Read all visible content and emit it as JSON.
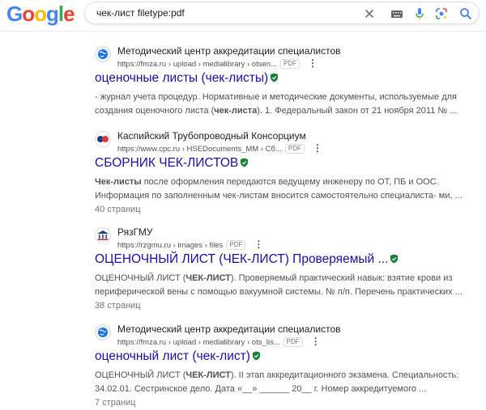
{
  "header": {
    "logo_letters": [
      {
        "ch": "G",
        "color": "#4285f4"
      },
      {
        "ch": "o",
        "color": "#ea4335"
      },
      {
        "ch": "o",
        "color": "#fbbc05"
      },
      {
        "ch": "g",
        "color": "#4285f4"
      },
      {
        "ch": "l",
        "color": "#34a853"
      },
      {
        "ch": "e",
        "color": "#ea4335"
      }
    ],
    "search_query": "чек-лист filetype:pdf",
    "icons": [
      "close-icon",
      "keyboard-icon",
      "microphone-icon",
      "lens-icon",
      "search-icon"
    ]
  },
  "results": [
    {
      "favicon": "globe-icon",
      "site_name": "Методический центр аккредитации специалистов",
      "url": "https://fmza.ru › upload › medialibrary › otsen...",
      "file_type": "PDF",
      "title": "оценочные листы (чек-листы)",
      "verified": true,
      "snippet_parts": [
        {
          "text": "- журнал учета процедур. Нормативные и методические документы, используемые для создания оценочного листа (",
          "bold": false
        },
        {
          "text": "чек-листа",
          "bold": true
        },
        {
          "text": "). 1. Федеральный закон от 21 ноября 2011 № ...",
          "bold": false
        }
      ],
      "pages": ""
    },
    {
      "favicon": "cpc-logo-icon",
      "site_name": "Каспийский Трубопроводный Консорциум",
      "url": "https://www.cpc.ru › HSEDocuments_MM › Сб...",
      "file_type": "PDF",
      "title": "СБОРНИК ЧЕК-ЛИСТОВ",
      "verified": true,
      "snippet_parts": [
        {
          "text": "Чек-листы",
          "bold": true
        },
        {
          "text": " после оформления передаются ведущему инженеру по ОТ, ПБ и ООС. Информация по заполненным чек-листам вносится самостоятельно специалиста- ми, ...",
          "bold": false
        }
      ],
      "pages": "40 страниц"
    },
    {
      "favicon": "rzgmu-emblem-icon",
      "site_name": "РязГМУ",
      "url": "https://rzgmu.ru › images › files",
      "file_type": "PDF",
      "title": "ОЦЕНОЧНЫЙ ЛИСТ (ЧЕК-ЛИСТ) Проверяемый ...",
      "verified": true,
      "snippet_parts": [
        {
          "text": "ОЦЕНОЧНЫЙ ЛИСТ (",
          "bold": false
        },
        {
          "text": "ЧЕК-ЛИСТ",
          "bold": true
        },
        {
          "text": "). Проверяемый практический навык: взятие крови из периферической вены с помощью вакуумной системы. № п/п. Перечень практических ...",
          "bold": false
        }
      ],
      "pages": "38 страниц"
    },
    {
      "favicon": "globe-icon",
      "site_name": "Методический центр аккредитации специалистов",
      "url": "https://fmza.ru › upload › medialibrary › ots_lis...",
      "file_type": "PDF",
      "title": "оценочный лист (чек-лист)",
      "verified": true,
      "snippet_parts": [
        {
          "text": "ОЦЕНОЧНЫЙ ЛИСТ (",
          "bold": false
        },
        {
          "text": "ЧЕК-ЛИСТ",
          "bold": true
        },
        {
          "text": "). II этап аккредитационного экзамена. Специальность: 34.02.01. Сестринское дело. Дата «__» ______ 20__ г. Номер аккредитуемого ...",
          "bold": false
        }
      ],
      "pages": "7 страниц"
    }
  ]
}
